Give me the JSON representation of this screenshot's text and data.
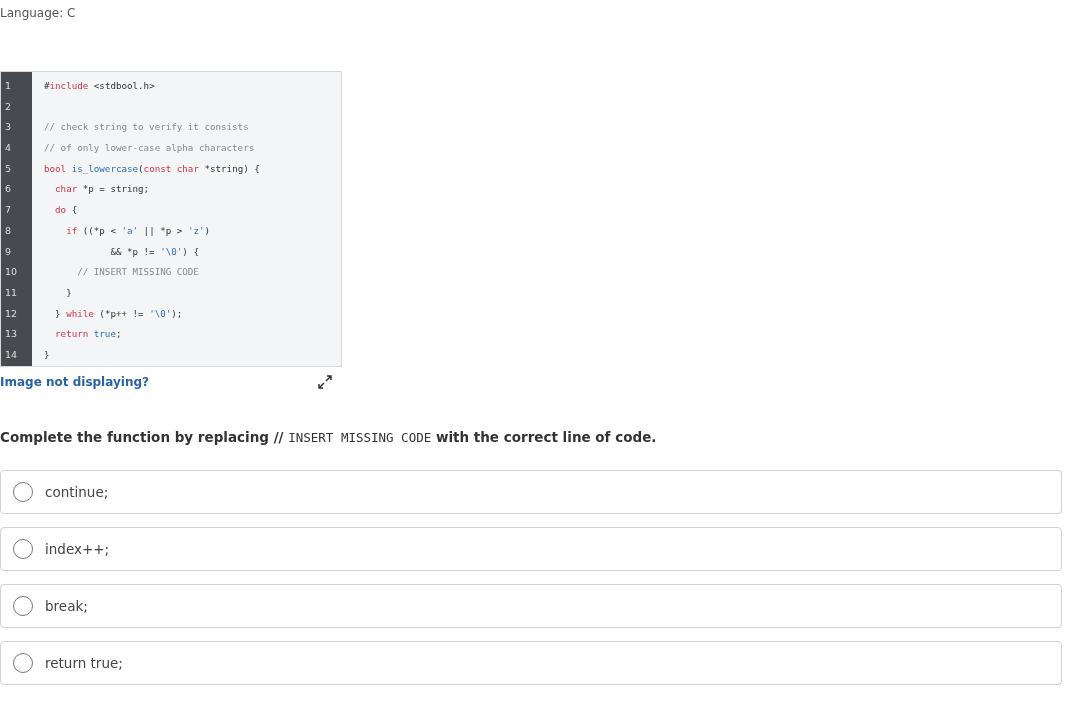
{
  "language_label": "Language: C",
  "code": {
    "lines": [
      {
        "number": "1",
        "tokens": [
          {
            "text": "#",
            "kind": "plain"
          },
          {
            "text": "include",
            "kind": "keyword"
          },
          {
            "text": " <stdbool.h>",
            "kind": "plain"
          }
        ]
      },
      {
        "number": "2"
      },
      {
        "number": "3",
        "tokens": [
          {
            "text": "// check string to verify it consists",
            "kind": "comment"
          }
        ]
      },
      {
        "number": "4",
        "tokens": [
          {
            "text": "// of only lower-case alpha characters",
            "kind": "comment"
          }
        ]
      },
      {
        "number": "5",
        "tokens": [
          {
            "text": "bool ",
            "kind": "keyword"
          },
          {
            "text": "is_lowercase",
            "kind": "name"
          },
          {
            "text": "(",
            "kind": "plain"
          },
          {
            "text": "const char",
            "kind": "keyword"
          },
          {
            "text": " *string) {",
            "kind": "plain"
          }
        ]
      },
      {
        "number": "6",
        "tokens": [
          {
            "text": "  char",
            "kind": "keyword"
          },
          {
            "text": " *p = string;",
            "kind": "plain"
          }
        ]
      },
      {
        "number": "7",
        "tokens": [
          {
            "text": "  do",
            "kind": "keyword"
          },
          {
            "text": " {",
            "kind": "plain"
          }
        ]
      },
      {
        "number": "8",
        "tokens": [
          {
            "text": "    if",
            "kind": "keyword"
          },
          {
            "text": " ((*p < ",
            "kind": "plain"
          },
          {
            "text": "'a'",
            "kind": "name"
          },
          {
            "text": " || *p > ",
            "kind": "plain"
          },
          {
            "text": "'z'",
            "kind": "name"
          },
          {
            "text": ")",
            "kind": "plain"
          }
        ]
      },
      {
        "number": "9",
        "tokens": [
          {
            "text": "            && *p != ",
            "kind": "plain"
          },
          {
            "text": "'\\0'",
            "kind": "name"
          },
          {
            "text": ") {",
            "kind": "plain"
          }
        ]
      },
      {
        "number": "10",
        "tokens": [
          {
            "text": "      // INSERT MISSING CODE",
            "kind": "comment"
          }
        ]
      },
      {
        "number": "11",
        "tokens": [
          {
            "text": "    }",
            "kind": "plain"
          }
        ]
      },
      {
        "number": "12",
        "tokens": [
          {
            "text": "  } ",
            "kind": "plain"
          },
          {
            "text": "while",
            "kind": "keyword"
          },
          {
            "text": " (*p++ != ",
            "kind": "plain"
          },
          {
            "text": "'\\0'",
            "kind": "name"
          },
          {
            "text": ");",
            "kind": "plain"
          }
        ]
      },
      {
        "number": "13",
        "tokens": [
          {
            "text": "  return ",
            "kind": "keyword"
          },
          {
            "text": "true",
            "kind": "name"
          },
          {
            "text": ";",
            "kind": "plain"
          }
        ]
      },
      {
        "number": "14",
        "tokens": [
          {
            "text": "}",
            "kind": "plain"
          }
        ]
      }
    ]
  },
  "image_link": "Image not displaying?",
  "question": [
    {
      "text": "Complete the function by replacing // ",
      "kind": "text"
    },
    {
      "text": "INSERT MISSING CODE",
      "kind": "code"
    },
    {
      "text": " with the correct line of code.",
      "kind": "text"
    }
  ],
  "options": [
    {
      "label": "continue;",
      "selected": false
    },
    {
      "label": "index++;",
      "selected": false
    },
    {
      "label": "break;",
      "selected": false
    },
    {
      "label": "return true;",
      "selected": false
    }
  ]
}
